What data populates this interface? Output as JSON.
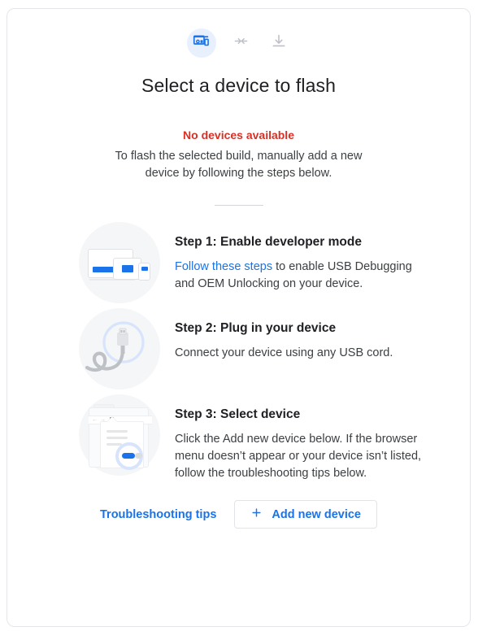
{
  "header": {
    "icons": [
      {
        "name": "devices-icon",
        "state": "active"
      },
      {
        "name": "converge-arrows-icon",
        "state": "inactive"
      },
      {
        "name": "download-icon",
        "state": "inactive"
      }
    ],
    "title": "Select a device to flash"
  },
  "status": {
    "error": "No devices available",
    "description": "To flash the selected build, manually add a new device by following the steps below."
  },
  "steps": [
    {
      "illustration": "devices-illustration",
      "title": "Step 1: Enable developer mode",
      "link_text": "Follow these steps",
      "text_after_link": " to enable USB Debugging and OEM Unlocking on your device."
    },
    {
      "illustration": "usb-cable-illustration",
      "title": "Step 2: Plug in your device",
      "text": "Connect your device using any USB cord."
    },
    {
      "illustration": "browser-menu-illustration",
      "title": "Step 3: Select device",
      "text": "Click the Add new device below. If the browser menu doesn’t appear or your device isn’t listed, follow the troubleshooting tips below."
    }
  ],
  "footer": {
    "troubleshooting_link": "Troubleshooting tips",
    "add_device_button": "Add new device",
    "add_icon": "plus-icon"
  },
  "colors": {
    "accent_blue": "#1a73e8",
    "error_red": "#d93025",
    "chip_blue": "#e8f0fe",
    "illustration_bg": "#f5f6f8",
    "text_primary": "#202124",
    "text_secondary": "#3c4043"
  }
}
